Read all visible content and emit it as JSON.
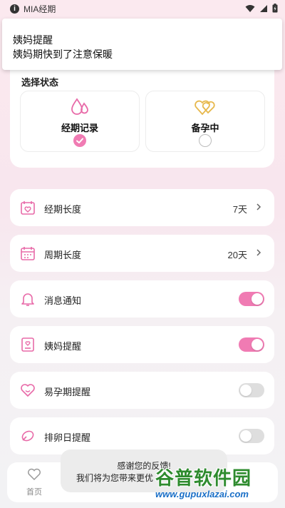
{
  "statusbar": {
    "app_name": "MIA经期"
  },
  "notification": {
    "title": "姨妈提醒",
    "body": "姨妈期快到了注意保暖"
  },
  "state_card": {
    "title": "选择状态",
    "options": [
      {
        "label": "经期记录",
        "selected": true,
        "icon": "drops-icon"
      },
      {
        "label": "备孕中",
        "selected": false,
        "icon": "hearts-icon"
      }
    ]
  },
  "settings": [
    {
      "label": "经期长度",
      "value": "7天",
      "icon": "calendar-heart-icon"
    },
    {
      "label": "周期长度",
      "value": "20天",
      "icon": "calendar-icon"
    },
    {
      "label": "消息通知",
      "toggle": true,
      "icon": "bell-icon"
    },
    {
      "label": "姨妈提醒",
      "toggle": true,
      "icon": "badge-icon"
    },
    {
      "label": "易孕期提醒",
      "toggle": false,
      "icon": "heart-smile-icon"
    },
    {
      "label": "排卵日提醒",
      "toggle": false,
      "icon": "egg-icon"
    }
  ],
  "bottom_nav": {
    "home_label": "首页"
  },
  "toast": {
    "line1": "感谢您的反馈!",
    "line2": "我们将为您带来更优"
  },
  "watermark": {
    "brand": "谷普软件园",
    "url": "www.gupuxlazai.com"
  },
  "colors": {
    "accent": "#f07bb3",
    "icon_pink": "#e86aa8",
    "icon_gold": "#e7b84c"
  }
}
